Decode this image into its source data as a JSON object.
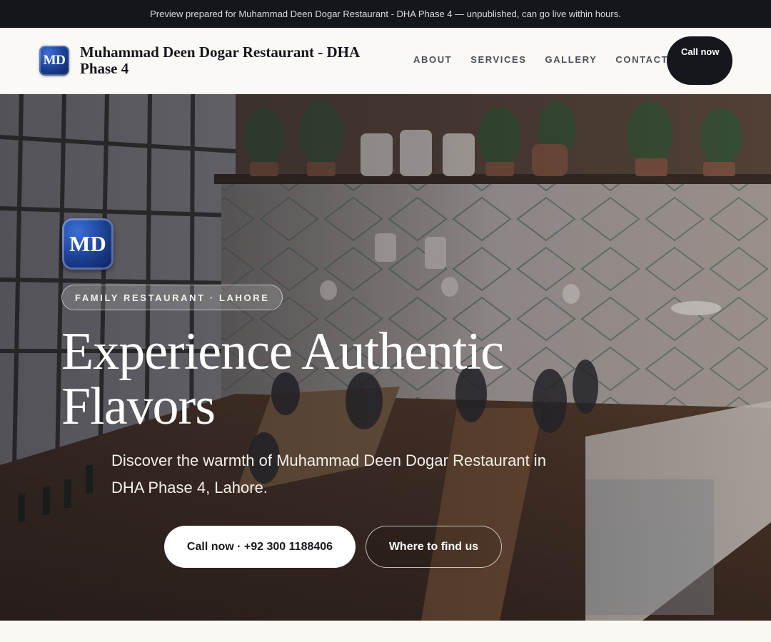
{
  "preview_bar": {
    "text": "Preview prepared for Muhammad Deen Dogar Restaurant - DHA Phase 4 — unpublished, can go live within hours."
  },
  "header": {
    "logo_text": "MD",
    "brand_name": "Muhammad Deen Dogar Restaurant - DHA Phase 4",
    "nav": [
      "ABOUT",
      "SERVICES",
      "GALLERY",
      "CONTACT"
    ],
    "call_label": "Call now"
  },
  "hero": {
    "logo_text": "MD",
    "tag": "FAMILY RESTAURANT · LAHORE",
    "title": "Experience Authentic Flavors",
    "subtitle": "Discover the warmth of Muhammad Deen Dogar Restaurant in DHA Phase 4, Lahore.",
    "primary_button": "Call now · +92 300 1188406",
    "secondary_button": "Where to find us",
    "background_image": "restaurant-interior-photo"
  },
  "colors": {
    "dark": "#15171c",
    "accent_blue": "#1a3e8f",
    "page_bg": "#faf8f3"
  }
}
